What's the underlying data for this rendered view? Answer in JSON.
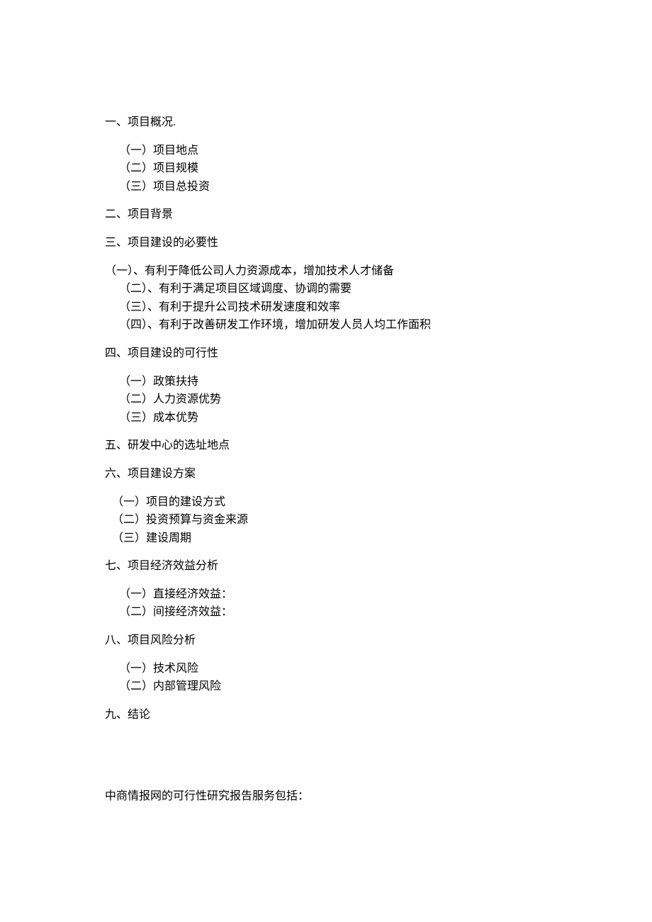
{
  "sections": {
    "s1": {
      "heading": "一、项目概况.",
      "items": [
        "（一）项目地点",
        "（二）项目规模",
        "（三）项目总投资"
      ]
    },
    "s2": {
      "heading": "二、项目背景"
    },
    "s3": {
      "heading": "三、项目建设的必要性",
      "items": [
        "（一）、有利于降低公司人力资源成本，增加技术人才储备",
        "（二）、有利于满足项目区域调度、协调的需要",
        "（三）、有利于提升公司技术研发速度和效率",
        "（四）、有利于改善研发工作环境，增加研发人员人均工作面积"
      ]
    },
    "s4": {
      "heading": "四、项目建设的可行性",
      "items": [
        "（一）政策扶持",
        "（二）人力资源优势",
        "（三）成本优势"
      ]
    },
    "s5": {
      "heading": "五、研发中心的选址地点"
    },
    "s6": {
      "heading": "六、项目建设方案",
      "items": [
        "（一）项目的建设方式",
        "（二）投资预算与资金来源",
        "（三）建设周期"
      ]
    },
    "s7": {
      "heading": "七、项目经济效益分析",
      "items": [
        "（一）直接经济效益：",
        "（二）间接经济效益："
      ]
    },
    "s8": {
      "heading": "八、项目风险分析",
      "items": [
        "（一）技术风险",
        "（二）内部管理风险"
      ]
    },
    "s9": {
      "heading": "九、结论"
    },
    "footer": "中商情报网的可行性研究报告服务包括："
  }
}
